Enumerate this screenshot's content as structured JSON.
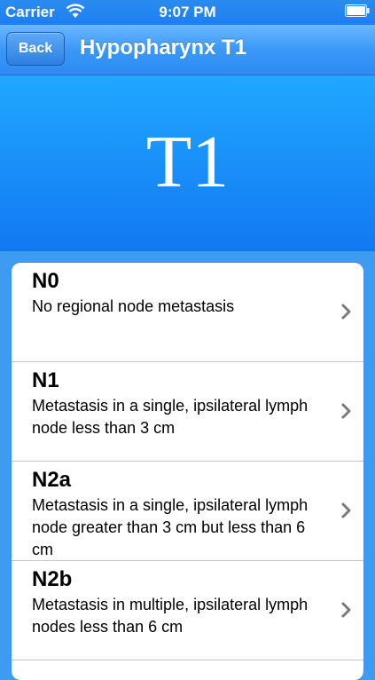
{
  "status_bar": {
    "carrier": "Carrier",
    "time": "9:07 PM",
    "wifi_icon": "wifi-icon",
    "battery_icon": "battery-icon"
  },
  "nav": {
    "back_label": "Back",
    "title": "Hypopharynx T1"
  },
  "banner": {
    "title": "T1"
  },
  "rows": [
    {
      "code": "N0",
      "description": "No regional node metastasis"
    },
    {
      "code": "N1",
      "description": "Metastasis in a single, ipsilateral lymph node less than 3 cm"
    },
    {
      "code": "N2a",
      "description": "Metastasis in a single, ipsilateral lymph node greater than 3 cm but less than 6 cm"
    },
    {
      "code": "N2b",
      "description": "Metastasis in multiple, ipsilateral lymph nodes less than 6 cm"
    }
  ],
  "colors": {
    "accent": "#1278f2",
    "nav_blue": "#3b98f8",
    "background": "#3d9bf2"
  }
}
